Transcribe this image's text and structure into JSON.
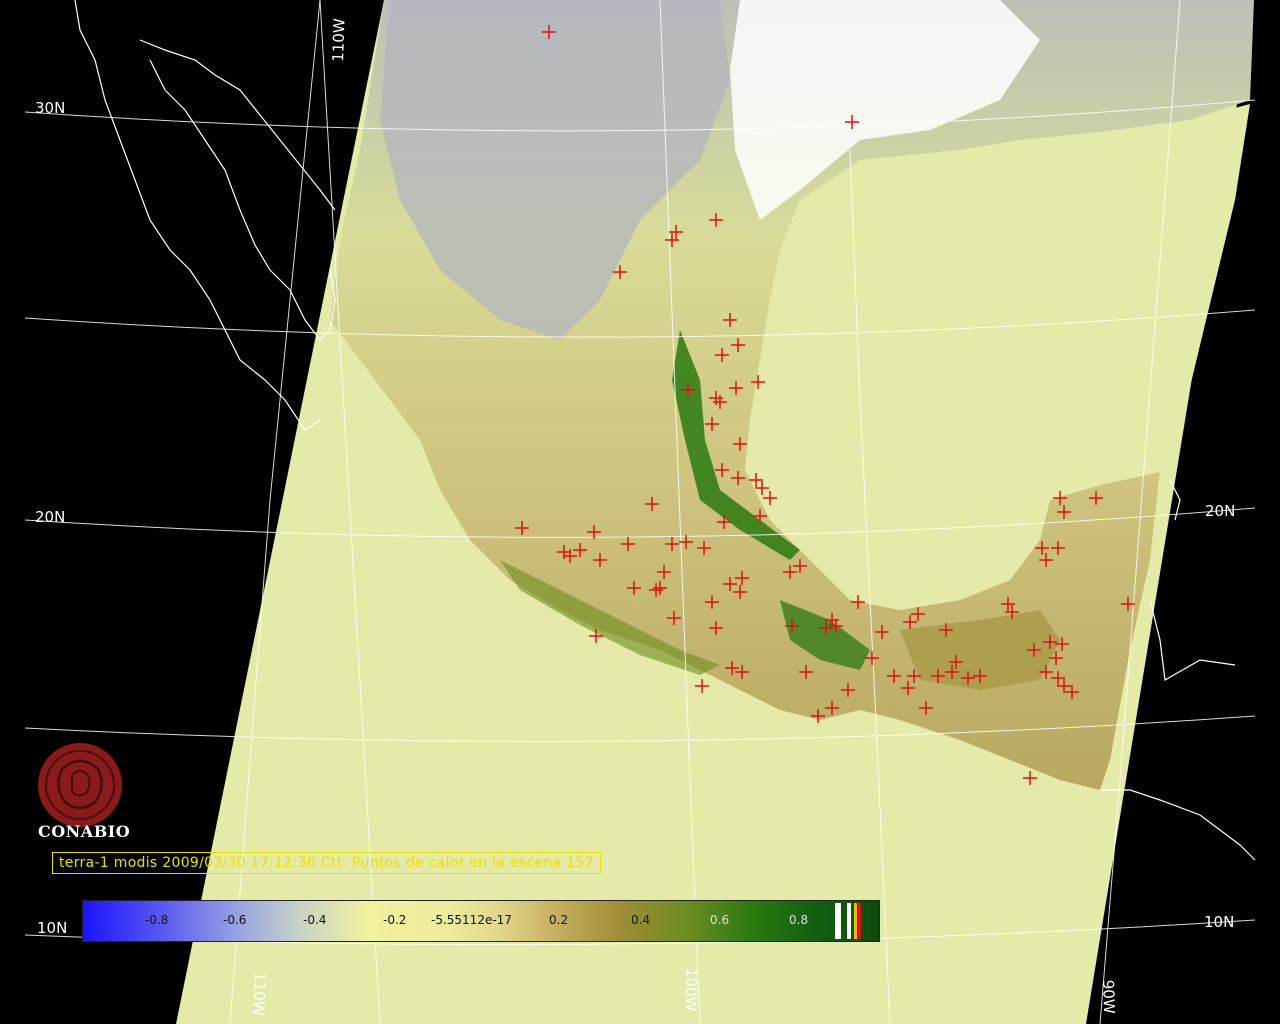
{
  "caption": "terra-1 modis 2009/03/30 17:12:36 Ctt. Puntos de calor en la escena 157",
  "logo": {
    "name": "CONABIO",
    "icon": "conabio-seal-icon",
    "color": "#8b1a1a"
  },
  "grid_labels": {
    "lat_30n_left": "30N",
    "lat_20n_left": "20N",
    "lat_20n_right": "20N",
    "lat_10n_left": "10N",
    "lat_10n_right": "10N",
    "lon_110w_top": "110W",
    "lon_110w_bottom": "110W",
    "lon_100w_bottom": "100W",
    "lon_90w_bottom": "90W"
  },
  "colorbar": {
    "ticks": [
      "-0.8",
      "-0.6",
      "-0.4",
      "-0.2",
      "-5.55112e-17",
      "0.2",
      "0.4",
      "0.6",
      "0.8"
    ],
    "low_color": "#1a14ff",
    "high_color": "#0e4a0e"
  },
  "colors": {
    "background": "#000000",
    "swath_fill": "#e6eaa8",
    "land_low": "#c8cc90",
    "hotspot": "#e01010",
    "caption": "#e8e000"
  }
}
